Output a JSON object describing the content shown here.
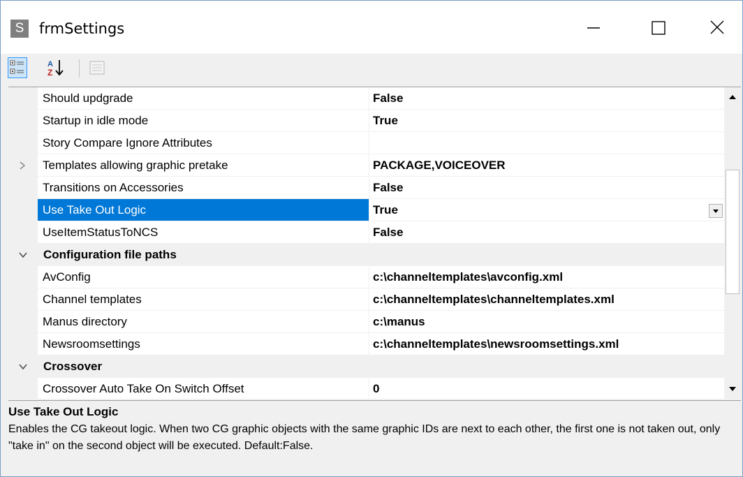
{
  "window": {
    "title": "frmSettings",
    "app_icon_letter": "S"
  },
  "toolbar": {
    "categorized_icon": "categorized-view-icon",
    "alphabetical_icon": "alphabetical-sort-icon",
    "property_pages_icon": "property-pages-icon"
  },
  "grid": {
    "rows": [
      {
        "name": "Should updgrade",
        "value": "False"
      },
      {
        "name": "Startup in idle mode",
        "value": "True"
      },
      {
        "name": "Story Compare Ignore Attributes",
        "value": ""
      },
      {
        "name": "Templates allowing graphic pretake",
        "value": "PACKAGE,VOICEOVER"
      },
      {
        "name": "Transitions on Accessories",
        "value": "False"
      },
      {
        "name": "Use Take Out Logic",
        "value": "True"
      },
      {
        "name": "UseItemStatusToNCS",
        "value": "False"
      },
      {
        "category": "Configuration file paths"
      },
      {
        "name": "AvConfig",
        "value": "c:\\channeltemplates\\avconfig.xml"
      },
      {
        "name": "Channel templates",
        "value": "c:\\channeltemplates\\channeltemplates.xml"
      },
      {
        "name": "Manus directory",
        "value": "c:\\manus"
      },
      {
        "name": "Newsroomsettings",
        "value": "c:\\channeltemplates\\newsroomsettings.xml"
      },
      {
        "category": "Crossover"
      },
      {
        "name": "Crossover Auto Take On Switch Offset",
        "value": "0"
      }
    ]
  },
  "description": {
    "title": "Use Take Out Logic",
    "text": "Enables the CG takeout logic. When two CG graphic objects with the same graphic IDs are next to each other, the first one is not taken out, only \"take in\" on the second object will be executed. Default:False."
  },
  "colors": {
    "selection": "#0078d7",
    "gutter": "#f0f0f0"
  }
}
